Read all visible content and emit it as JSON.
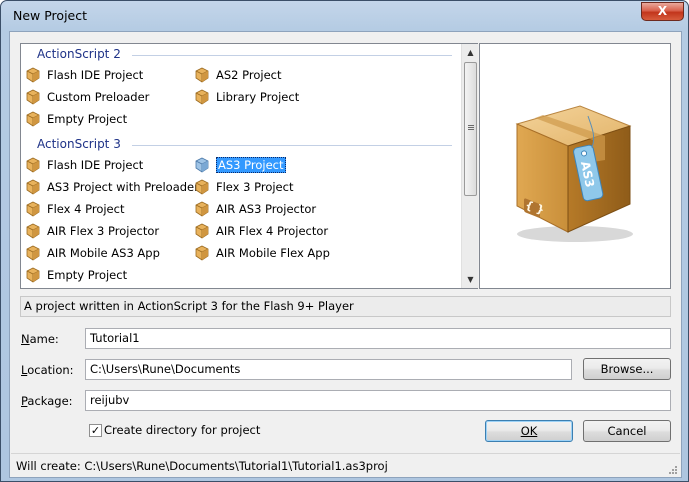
{
  "window": {
    "title": "New Project",
    "close_label": "X"
  },
  "groups": [
    {
      "header": "ActionScript 2",
      "items": [
        {
          "label": "Flash IDE Project",
          "icon": "package-box-icon"
        },
        {
          "label": "AS2 Project",
          "icon": "package-box-icon"
        },
        {
          "label": "Custom Preloader",
          "icon": "package-box-icon"
        },
        {
          "label": "Library Project",
          "icon": "package-box-icon"
        },
        {
          "label": "Empty Project",
          "icon": "package-box-icon"
        }
      ]
    },
    {
      "header": "ActionScript 3",
      "items": [
        {
          "label": "Flash IDE Project",
          "icon": "package-box-icon"
        },
        {
          "label": "AS3 Project",
          "icon": "package-box-icon",
          "selected": true
        },
        {
          "label": "AS3 Project with Preloader",
          "icon": "package-box-icon"
        },
        {
          "label": "Flex 3 Project",
          "icon": "package-box-icon"
        },
        {
          "label": "Flex 4 Project",
          "icon": "package-box-icon"
        },
        {
          "label": "AIR AS3 Projector",
          "icon": "package-box-icon"
        },
        {
          "label": "AIR Flex 3 Projector",
          "icon": "package-box-icon"
        },
        {
          "label": "AIR Flex 4 Projector",
          "icon": "package-box-icon"
        },
        {
          "label": "AIR Mobile AS3 App",
          "icon": "package-box-icon"
        },
        {
          "label": "AIR Mobile Flex App",
          "icon": "package-box-icon"
        },
        {
          "label": "Empty Project",
          "icon": "package-box-icon"
        }
      ]
    }
  ],
  "preview": {
    "icon": "as3-package-box-icon",
    "tag_text": "AS3"
  },
  "description": "A project written in ActionScript 3 for the Flash 9+ Player",
  "form": {
    "name_label": "Name:",
    "name_value": "Tutorial1",
    "location_label": "Location:",
    "location_value": "C:\\Users\\Rune\\Documents",
    "browse_label": "Browse...",
    "package_label": "Package:",
    "package_value": "reijubv",
    "create_dir_label": "Create directory for project",
    "create_dir_checked": true,
    "ok_label": "OK",
    "cancel_label": "Cancel"
  },
  "status": "Will create: C:\\Users\\Rune\\Documents\\Tutorial1\\Tutorial1.as3proj",
  "colors": {
    "group_header": "#1e3287",
    "selection": "#3399ff",
    "box_tan": "#e8b25c"
  }
}
